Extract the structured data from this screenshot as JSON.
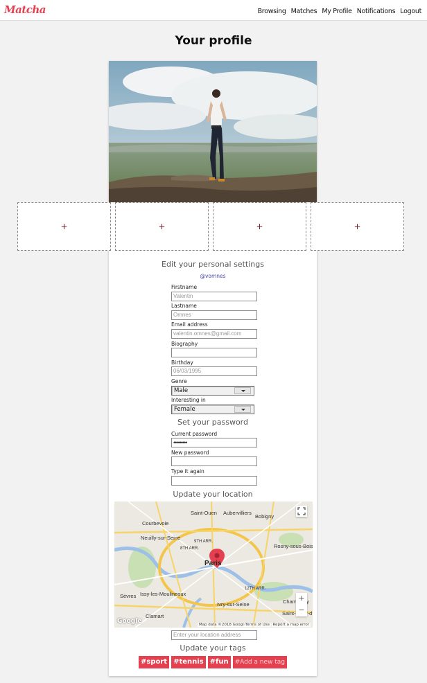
{
  "nav": {
    "logo": "Matcha",
    "links": [
      "Browsing",
      "Matches",
      "My Profile",
      "Notifications",
      "Logout"
    ]
  },
  "page": {
    "title": "Your profile"
  },
  "photos": {
    "slot_label": "+"
  },
  "settings": {
    "heading": "Edit your personal settings",
    "username": "@vomnes",
    "firstname": {
      "label": "Firstname",
      "placeholder": "Valentin"
    },
    "lastname": {
      "label": "Lastname",
      "placeholder": "Omnes"
    },
    "email": {
      "label": "Email address",
      "placeholder": "valentin.omnes@gmail.com"
    },
    "biography": {
      "label": "Biography",
      "value": ""
    },
    "birthday": {
      "label": "Birthday",
      "placeholder": "06/03/1995"
    },
    "genre": {
      "label": "Genre",
      "value": "Male"
    },
    "interest": {
      "label": "Interesting in",
      "value": "Female"
    }
  },
  "password": {
    "heading": "Set your password",
    "current": {
      "label": "Current password",
      "value": "•••••••••"
    },
    "new": {
      "label": "New password",
      "value": ""
    },
    "again": {
      "label": "Type it again",
      "value": ""
    }
  },
  "location": {
    "heading": "Update your location",
    "placeholder": "Enter your location address",
    "map": {
      "places": [
        "Saint-Ouen",
        "Aubervilliers",
        "Bobigny",
        "Courbevoie",
        "Neuilly-sur-Seine",
        "9TH ARR.",
        "8TH ARR.",
        "Rosny-sous-Bois",
        "Paris",
        "12TH ARR.",
        "Sèvres",
        "Issy-les-Moulineaux",
        "Ivry-sur-Seine",
        "Clamart",
        "Champigny",
        "Saint-Maur-d"
      ],
      "attribution": "Map data ©2018 Google",
      "terms": "Terms of Use",
      "report": "Report a map error",
      "logo": "Google",
      "zoom_in": "+",
      "zoom_out": "−"
    }
  },
  "tags": {
    "heading": "Update your tags",
    "items": [
      "#sport",
      "#tennis",
      "#fun"
    ],
    "add_placeholder": "#Add a new tag"
  },
  "colors": {
    "accent": "#e5404f",
    "link": "#4a4ab0"
  }
}
